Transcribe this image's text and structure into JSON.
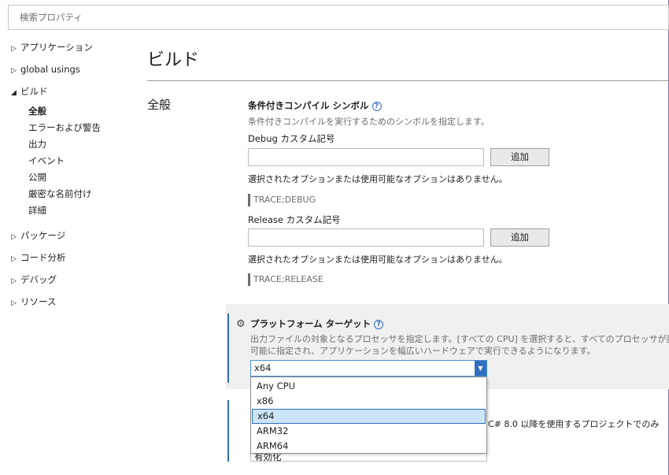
{
  "search": {
    "placeholder": "検索プロパティ"
  },
  "sidebar": {
    "app": "アプリケーション",
    "global": "global usings",
    "build": "ビルド",
    "build_children": [
      "全般",
      "エラーおよび警告",
      "出力",
      "イベント",
      "公開",
      "厳密な名前付け",
      "詳細"
    ],
    "package": "パッケージ",
    "analysis": "コード分析",
    "debug": "デバッグ",
    "resources": "リソース"
  },
  "main": {
    "page_title": "ビルド",
    "section": "全般",
    "symbols": {
      "heading": "条件付きコンパイル シンボル",
      "desc": "条件付きコンパイルを実行するためのシンボルを指定します。",
      "debug_label": "Debug カスタム記号",
      "debug_value": "",
      "debug_add": "追加",
      "debug_none": "選択されたオプションまたは使用可能なオプションはありません。",
      "debug_chip": "TRACE;DEBUG",
      "release_label": "Release カスタム記号",
      "release_value": "",
      "release_add": "追加",
      "release_none": "選択されたオプションまたは使用可能なオプションはありません。",
      "release_chip": "TRACE;RELEASE"
    },
    "platform": {
      "heading": "プラットフォーム ターゲット",
      "desc1": "出力ファイルの対象となるプロセッサを指定します。[すべての CPU] を選択すると、すべてのプロセッサが許容",
      "desc2": "可能に指定され、アプリケーションを幅広いハードウェアで実行できるようになります。",
      "selected": "x64",
      "options": [
        "Any CPU",
        "x86",
        "x64",
        "ARM32",
        "ARM64"
      ]
    },
    "nullable": {
      "desc_partial": "C# 8.0 以降を使用するプロジェクトでのみ",
      "value_partial": "有効化"
    }
  },
  "colors": {
    "accent": "#2f6fbf",
    "frame": "#7b6fb8",
    "panel": "#f0f0f0"
  },
  "icons": {
    "info": "info-circle-icon",
    "gear": "gear-icon",
    "caret": "caret-right-icon"
  }
}
